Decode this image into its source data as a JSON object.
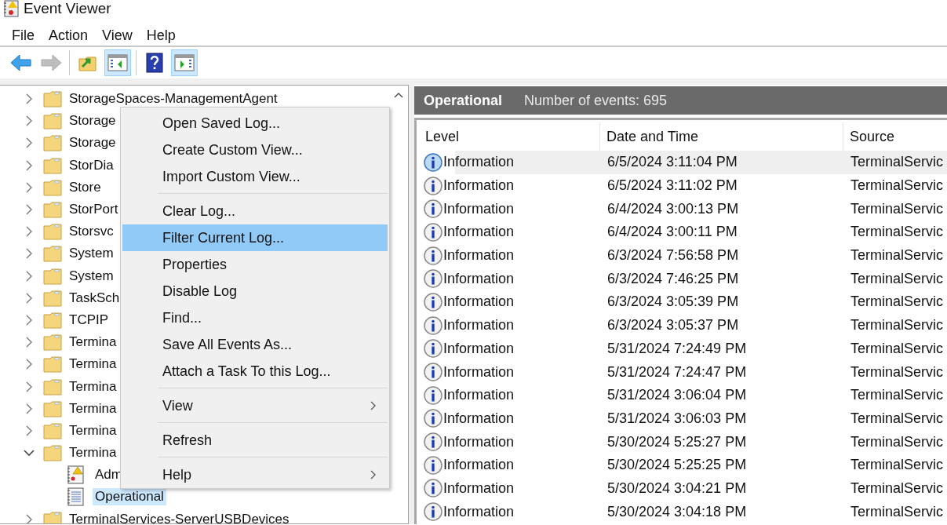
{
  "window": {
    "title": "Event Viewer"
  },
  "menu_bar": [
    "File",
    "Action",
    "View",
    "Help"
  ],
  "toolbar": [
    [
      {
        "kind": "back",
        "pressed": false,
        "disabled": false
      },
      {
        "kind": "forward",
        "pressed": false,
        "disabled": true
      }
    ],
    [
      {
        "kind": "up-folder",
        "pressed": false,
        "disabled": false
      },
      {
        "kind": "console-tree",
        "pressed": true,
        "disabled": false
      }
    ],
    [
      {
        "kind": "help",
        "pressed": false,
        "disabled": false
      },
      {
        "kind": "action-pane",
        "pressed": true,
        "disabled": false
      }
    ]
  ],
  "tree": [
    {
      "label": "StorageSpaces-ManagementAgent",
      "kind": "folder",
      "expanded": false,
      "selected": false
    },
    {
      "label": "Storage",
      "kind": "folder",
      "expanded": false,
      "selected": false
    },
    {
      "label": "Storage",
      "kind": "folder",
      "expanded": false,
      "selected": false
    },
    {
      "label": "StorDia",
      "kind": "folder",
      "expanded": false,
      "selected": false
    },
    {
      "label": "Store",
      "kind": "folder",
      "expanded": false,
      "selected": false
    },
    {
      "label": "StorPort",
      "kind": "folder",
      "expanded": false,
      "selected": false
    },
    {
      "label": "Storsvc",
      "kind": "folder",
      "expanded": false,
      "selected": false
    },
    {
      "label": "System",
      "kind": "folder",
      "expanded": false,
      "selected": false
    },
    {
      "label": "System",
      "kind": "folder",
      "expanded": false,
      "selected": false
    },
    {
      "label": "TaskSch",
      "kind": "folder",
      "expanded": false,
      "selected": false
    },
    {
      "label": "TCPIP",
      "kind": "folder",
      "expanded": false,
      "selected": false
    },
    {
      "label": "Termina",
      "kind": "folder",
      "expanded": false,
      "selected": false
    },
    {
      "label": "Termina",
      "kind": "folder",
      "expanded": false,
      "selected": false
    },
    {
      "label": "Termina",
      "kind": "folder",
      "expanded": false,
      "selected": false
    },
    {
      "label": "Termina",
      "kind": "folder",
      "expanded": false,
      "selected": false
    },
    {
      "label": "Termina",
      "kind": "folder",
      "expanded": false,
      "selected": false
    },
    {
      "label": "Termina",
      "kind": "folder",
      "expanded": true,
      "selected": false,
      "children": [
        {
          "label": "Adm",
          "kind": "admin-log",
          "selected": false
        },
        {
          "label": "Operational",
          "kind": "log",
          "selected": true
        }
      ]
    },
    {
      "label": "TerminalServices-ServerUSBDevices",
      "kind": "folder",
      "expanded": false,
      "selected": false
    }
  ],
  "context_menu": [
    {
      "kind": "item",
      "label": "Open Saved Log...",
      "selected": false,
      "submenu": false
    },
    {
      "kind": "item",
      "label": "Create Custom View...",
      "selected": false,
      "submenu": false
    },
    {
      "kind": "item",
      "label": "Import Custom View...",
      "selected": false,
      "submenu": false
    },
    {
      "kind": "separator"
    },
    {
      "kind": "item",
      "label": "Clear Log...",
      "selected": false,
      "submenu": false
    },
    {
      "kind": "item",
      "label": "Filter Current Log...",
      "selected": true,
      "submenu": false
    },
    {
      "kind": "item",
      "label": "Properties",
      "selected": false,
      "submenu": false
    },
    {
      "kind": "item",
      "label": "Disable Log",
      "selected": false,
      "submenu": false
    },
    {
      "kind": "item",
      "label": "Find...",
      "selected": false,
      "submenu": false
    },
    {
      "kind": "item",
      "label": "Save All Events As...",
      "selected": false,
      "submenu": false
    },
    {
      "kind": "item",
      "label": "Attach a Task To this Log...",
      "selected": false,
      "submenu": false
    },
    {
      "kind": "separator"
    },
    {
      "kind": "item",
      "label": "View",
      "selected": false,
      "submenu": true
    },
    {
      "kind": "separator"
    },
    {
      "kind": "item",
      "label": "Refresh",
      "selected": false,
      "submenu": false
    },
    {
      "kind": "separator"
    },
    {
      "kind": "item",
      "label": "Help",
      "selected": false,
      "submenu": true
    }
  ],
  "log_header": {
    "title": "Operational",
    "count": "Number of events: 695"
  },
  "table": {
    "columns": [
      "Level",
      "Date and Time",
      "Source"
    ],
    "rows": [
      {
        "level": "Information",
        "date_time": "6/5/2024 3:11:04 PM",
        "source": "TerminalServic",
        "selected": true
      },
      {
        "level": "Information",
        "date_time": "6/5/2024 3:11:02 PM",
        "source": "TerminalServic",
        "selected": false
      },
      {
        "level": "Information",
        "date_time": "6/4/2024 3:00:13 PM",
        "source": "TerminalServic",
        "selected": false
      },
      {
        "level": "Information",
        "date_time": "6/4/2024 3:00:11 PM",
        "source": "TerminalServic",
        "selected": false
      },
      {
        "level": "Information",
        "date_time": "6/3/2024 7:56:58 PM",
        "source": "TerminalServic",
        "selected": false
      },
      {
        "level": "Information",
        "date_time": "6/3/2024 7:46:25 PM",
        "source": "TerminalServic",
        "selected": false
      },
      {
        "level": "Information",
        "date_time": "6/3/2024 3:05:39 PM",
        "source": "TerminalServic",
        "selected": false
      },
      {
        "level": "Information",
        "date_time": "6/3/2024 3:05:37 PM",
        "source": "TerminalServic",
        "selected": false
      },
      {
        "level": "Information",
        "date_time": "5/31/2024 7:24:49 PM",
        "source": "TerminalServic",
        "selected": false
      },
      {
        "level": "Information",
        "date_time": "5/31/2024 7:24:47 PM",
        "source": "TerminalServic",
        "selected": false
      },
      {
        "level": "Information",
        "date_time": "5/31/2024 3:06:04 PM",
        "source": "TerminalServic",
        "selected": false
      },
      {
        "level": "Information",
        "date_time": "5/31/2024 3:06:03 PM",
        "source": "TerminalServic",
        "selected": false
      },
      {
        "level": "Information",
        "date_time": "5/30/2024 5:25:27 PM",
        "source": "TerminalServic",
        "selected": false
      },
      {
        "level": "Information",
        "date_time": "5/30/2024 5:25:25 PM",
        "source": "TerminalServic",
        "selected": false
      },
      {
        "level": "Information",
        "date_time": "5/30/2024 3:04:21 PM",
        "source": "TerminalServic",
        "selected": false
      },
      {
        "level": "Information",
        "date_time": "5/30/2024 3:04:18 PM",
        "source": "TerminalServic",
        "selected": false
      }
    ]
  }
}
